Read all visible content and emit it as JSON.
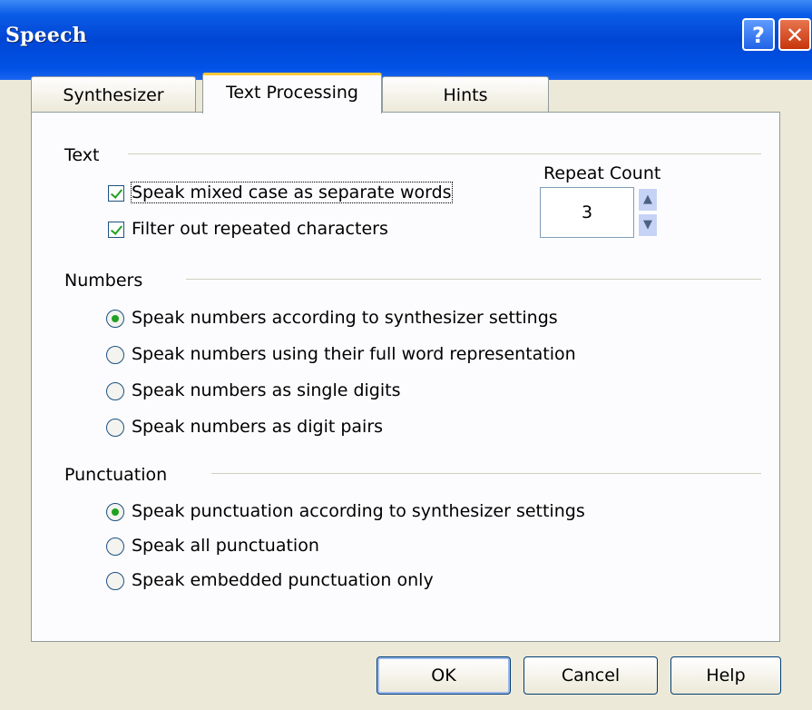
{
  "window": {
    "title": "Speech",
    "help_glyph": "?",
    "close_glyph": "✕"
  },
  "tabs": [
    {
      "label": "Synthesizer"
    },
    {
      "label": "Text Processing"
    },
    {
      "label": "Hints"
    }
  ],
  "active_tab": "Text Processing",
  "text_group": {
    "label": "Text",
    "checkboxes": [
      {
        "label": "Speak mixed case as separate words",
        "checked": true
      },
      {
        "label": "Filter out repeated characters",
        "checked": true
      }
    ],
    "repeat_count": {
      "label": "Repeat Count",
      "value": "3"
    }
  },
  "numbers_group": {
    "label": "Numbers",
    "options": [
      {
        "label": "Speak numbers according to synthesizer settings",
        "selected": true
      },
      {
        "label": "Speak numbers using their full word representation",
        "selected": false
      },
      {
        "label": "Speak numbers as single digits",
        "selected": false
      },
      {
        "label": "Speak numbers as digit pairs",
        "selected": false
      }
    ]
  },
  "punctuation_group": {
    "label": "Punctuation",
    "options": [
      {
        "label": "Speak punctuation according to synthesizer settings",
        "selected": true
      },
      {
        "label": "Speak all punctuation",
        "selected": false
      },
      {
        "label": "Speak embedded punctuation only",
        "selected": false
      }
    ]
  },
  "buttons": {
    "ok": "OK",
    "cancel": "Cancel",
    "help": "Help"
  },
  "colors": {
    "titlebar": "#0052e6",
    "face": "#ece9d8",
    "active_tab_accent": "#ffc83c",
    "check_green": "#21a121"
  }
}
